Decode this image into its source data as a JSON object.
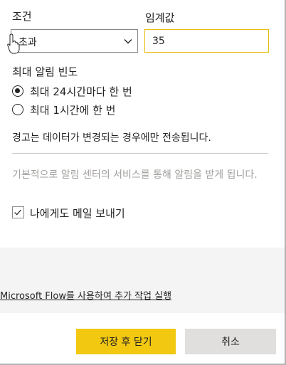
{
  "condition": {
    "label": "조건",
    "selected": "초과"
  },
  "threshold": {
    "label": "임계값",
    "value": "35"
  },
  "frequency": {
    "label": "최대 알림 빈도",
    "options": [
      {
        "label": "최대 24시간마다 한 번",
        "selected": true
      },
      {
        "label": "최대 1시간에 한 번",
        "selected": false
      }
    ]
  },
  "notice": "경고는 데이터가 변경되는 경우에만 전송됩니다.",
  "hint": "기본적으로 알림 센터의 서비스를 통해 알림을 받게 됩니다.",
  "email": {
    "label": "나에게도 메일 보내기",
    "checked": true
  },
  "flow_link": "Microsoft Flow를 사용하여 추가 작업 실행",
  "buttons": {
    "save_close": "저장 후 닫기",
    "cancel": "취소"
  },
  "colors": {
    "accent": "#f2c811",
    "input_border": "#e8bd0e"
  }
}
